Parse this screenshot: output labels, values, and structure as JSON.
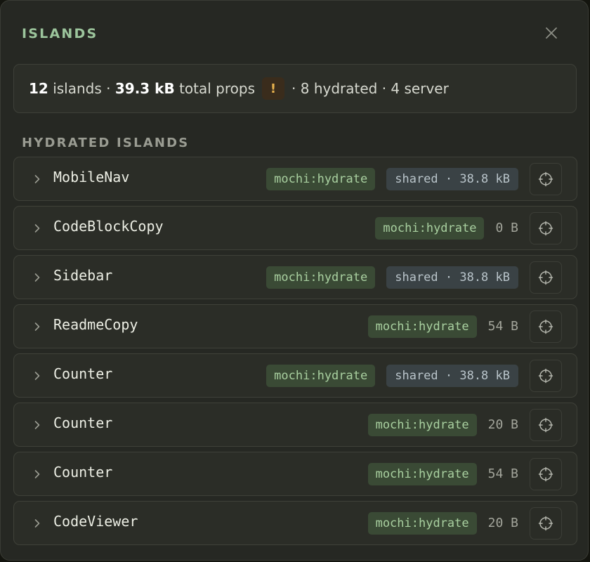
{
  "header": {
    "title": "ISLANDS",
    "close_icon": "close-icon"
  },
  "summary": {
    "islands_count": "12",
    "islands_label": "islands",
    "sep": "·",
    "total_props": "39.3 kB",
    "total_props_label": "total props",
    "warning": "!",
    "hydrated": "8 hydrated",
    "server": "4 server"
  },
  "section": {
    "title": "HYDRATED ISLANDS"
  },
  "islands": [
    {
      "name": "MobileNav",
      "directive": "mochi:hydrate",
      "props": "shared · 38.8 kB",
      "shared": true
    },
    {
      "name": "CodeBlockCopy",
      "directive": "mochi:hydrate",
      "props": "0 B",
      "shared": false
    },
    {
      "name": "Sidebar",
      "directive": "mochi:hydrate",
      "props": "shared · 38.8 kB",
      "shared": true
    },
    {
      "name": "ReadmeCopy",
      "directive": "mochi:hydrate",
      "props": "54 B",
      "shared": false
    },
    {
      "name": "Counter",
      "directive": "mochi:hydrate",
      "props": "shared · 38.8 kB",
      "shared": true
    },
    {
      "name": "Counter",
      "directive": "mochi:hydrate",
      "props": "20 B",
      "shared": false
    },
    {
      "name": "Counter",
      "directive": "mochi:hydrate",
      "props": "54 B",
      "shared": false
    },
    {
      "name": "CodeViewer",
      "directive": "mochi:hydrate",
      "props": "20 B",
      "shared": false
    }
  ],
  "colors": {
    "accent_green": "#9cc59c",
    "warning": "#e8b24e",
    "panel_bg": "#262823"
  }
}
